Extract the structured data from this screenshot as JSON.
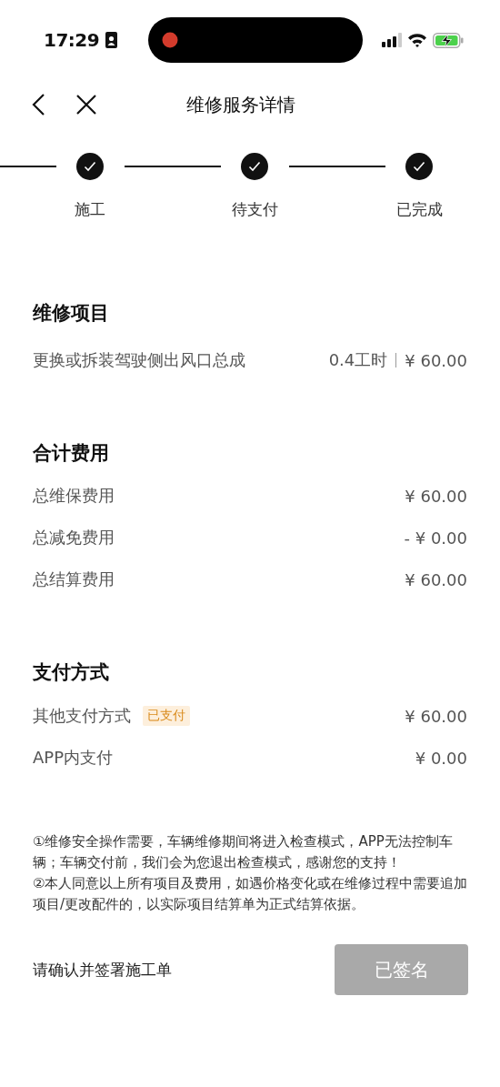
{
  "status_bar": {
    "time": "17:29"
  },
  "nav": {
    "title": "维修服务详情"
  },
  "steps": [
    {
      "label": "施工",
      "done": true
    },
    {
      "label": "待支付",
      "done": true
    },
    {
      "label": "已完成",
      "done": true
    }
  ],
  "repair_items": {
    "title": "维修项目",
    "items": [
      {
        "name": "更换或拆装驾驶侧出风口总成",
        "hours": "0.4工时",
        "price": "¥ 60.00"
      }
    ]
  },
  "costs": {
    "title": "合计费用",
    "rows": [
      {
        "label": "总维保费用",
        "value": "¥ 60.00"
      },
      {
        "label": "总减免费用",
        "value": "- ¥ 0.00"
      },
      {
        "label": "总结算费用",
        "value": "¥ 60.00"
      }
    ]
  },
  "payment": {
    "title": "支付方式",
    "rows": [
      {
        "label": "其他支付方式",
        "badge": "已支付",
        "value": "¥ 60.00"
      },
      {
        "label": "APP内支付",
        "value": "¥ 0.00"
      }
    ]
  },
  "notes": [
    "①维修安全操作需要，车辆维修期间将进入检查模式，APP无法控制车辆；车辆交付前，我们会为您退出检查模式，感谢您的支持！",
    "②本人同意以上所有项目及费用，如遇价格变化或在维修过程中需要追加项目/更改配件的，以实际项目结算单为正式结算依据。"
  ],
  "sign": {
    "prompt": "请确认并签署施工单",
    "button": {
      "label": "已签名",
      "disabled": true
    }
  }
}
